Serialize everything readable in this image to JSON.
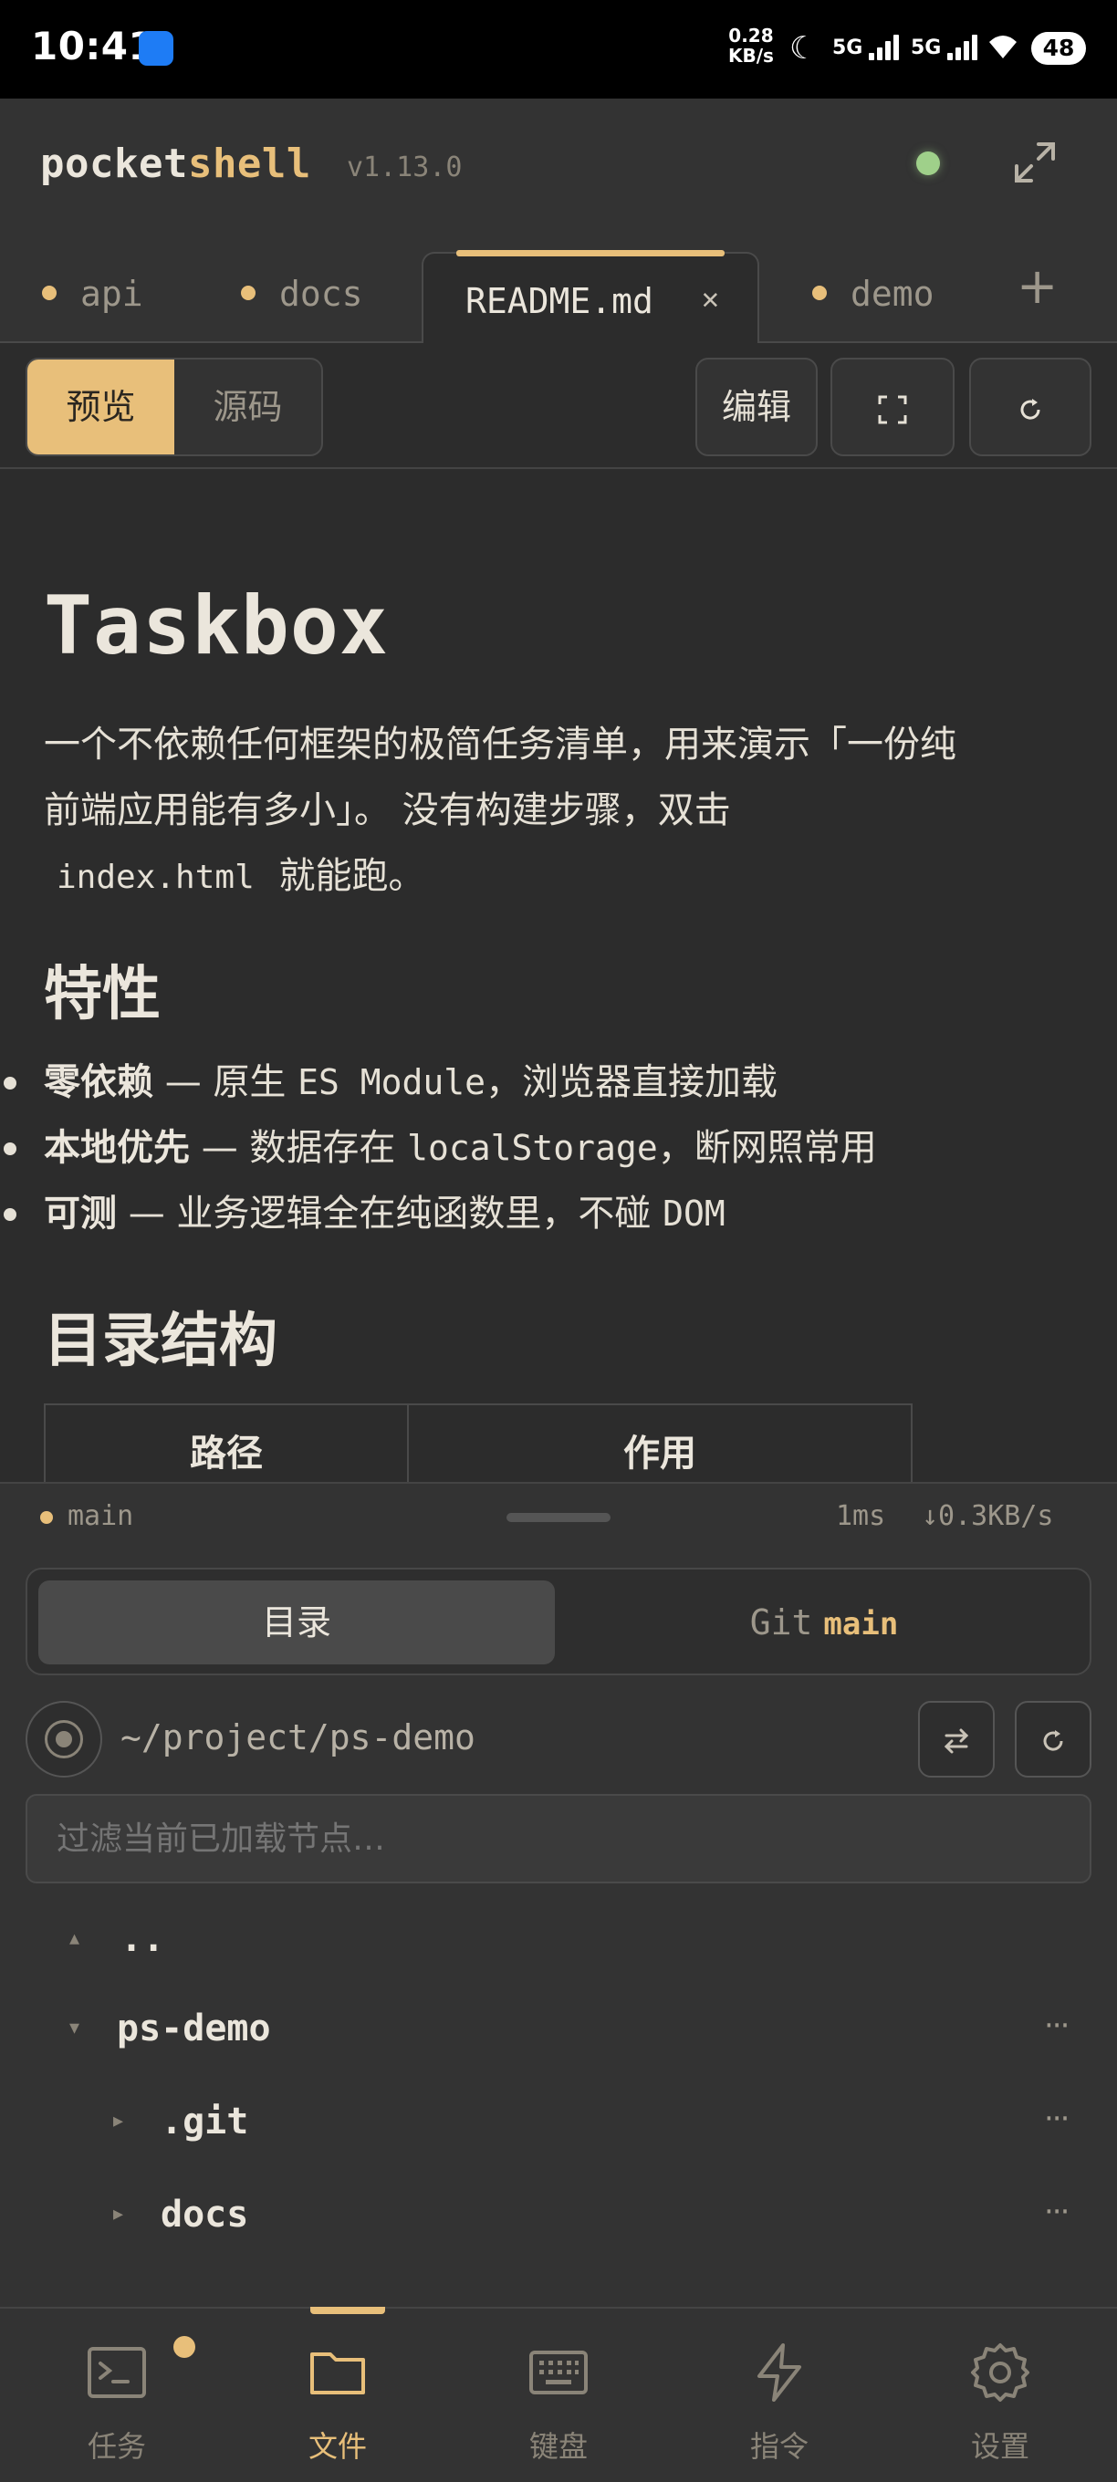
{
  "status_bar": {
    "time": "10:41",
    "net_speed_value": "0.28",
    "net_speed_unit": "KB/s",
    "net1": "5G",
    "net2": "5G",
    "battery": "48"
  },
  "header": {
    "brand_part1": "pocket",
    "brand_part2": "shell",
    "version": "v1.13.0"
  },
  "tabs": [
    {
      "label": "api"
    },
    {
      "label": "docs"
    },
    {
      "label": "README.md",
      "active": true
    },
    {
      "label": "demo"
    }
  ],
  "toolbar": {
    "preview": "预览",
    "source": "源码",
    "edit": "编辑"
  },
  "markdown": {
    "title": "Taskbox",
    "intro_line1": "一个不依赖任何框架的极简任务清单，用来演示「一份纯",
    "intro_line2": "前端应用能有多小」。 没有构建步骤，双击",
    "intro_code": "index.html",
    "intro_tail": "就能跑。",
    "features_heading": "特性",
    "features": [
      {
        "bold": "零依赖",
        "pre": " — 原生 ",
        "mono": "ES Module",
        "post": "，浏览器直接加载"
      },
      {
        "bold": "本地优先",
        "pre": " — 数据存在 ",
        "mono": "localStorage",
        "post": "，断网照常用"
      },
      {
        "bold": "可测",
        "pre": " — 业务逻辑全在纯函数里，不碰 ",
        "mono": "DOM",
        "post": ""
      }
    ],
    "structure_heading": "目录结构",
    "table_headers": [
      "路径",
      "作用"
    ]
  },
  "status_strip": {
    "branch": "main",
    "latency": "1ms",
    "speed": "↓0.3KB/s"
  },
  "panel": {
    "tab_dir": "目录",
    "tab_git": "Git",
    "tab_git_branch": "main",
    "path": "~/project/ps-demo",
    "filter_placeholder": "过滤当前已加载节点…",
    "tree": [
      {
        "name": "..",
        "caret": "▴"
      },
      {
        "name": "ps-demo",
        "caret": "▾"
      },
      {
        "name": ".git",
        "caret": "▸"
      },
      {
        "name": "docs",
        "caret": "▸"
      }
    ],
    "more": "···"
  },
  "bottom_nav": [
    {
      "label": "任务",
      "icon": "terminal-icon"
    },
    {
      "label": "文件",
      "icon": "folder-icon",
      "active": true
    },
    {
      "label": "键盘",
      "icon": "keyboard-icon"
    },
    {
      "label": "指令",
      "icon": "lightning-icon"
    },
    {
      "label": "设置",
      "icon": "gear-icon"
    }
  ],
  "colors": {
    "accent": "#e8bf7a",
    "background": "#2c2c2c",
    "online": "#9fd08a"
  }
}
